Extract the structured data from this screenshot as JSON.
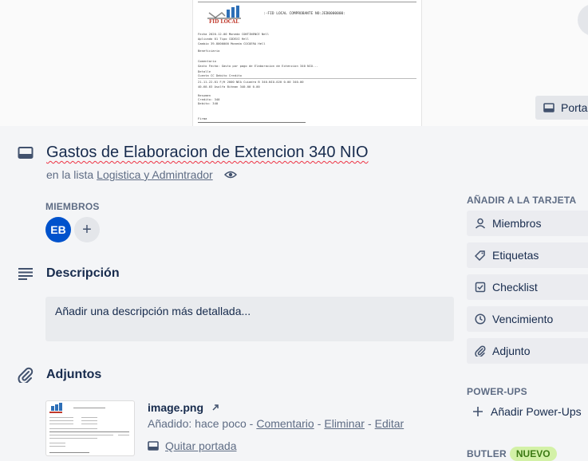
{
  "cover": {
    "doc_logo_text": "FID LOCAL",
    "doc_title": ":-FID LOCAL COMPROBANTE NO:JED0000000:",
    "doc_rows": [
      "Fecha        2020-12-00           Moneda      CONTINENCE         Nell",
      "Aplicado     01                   Tipo        CODEXI             Hell",
      "Cambio       39.8000000           Moneda      COCOERA            Hell",
      "Beneficiario",
      "Comentario",
      "Gasto Fecha: Gasto por pago de Elaboracion de Extencion 340 NIO...",
      "Detalle",
      "Cuenta                    CC                    Debito       Credito",
      "21-11-22-01 F/H 2000 NEA Cuiadra B 340-NIO-020        0.00       340.00",
      "40-60-03 Asolfa Bitman                               340.00         0.00",
      "Resumen",
      "Credito:      340",
      "Debito:       340",
      "Firma"
    ]
  },
  "cover_button": {
    "label": "Porta"
  },
  "card": {
    "title": "Gastos de Elaboracion de Extencion 340 NIO",
    "in_list_prefix": "en la lista",
    "list_name": "Logistica y Admintrador"
  },
  "members": {
    "label": "MIEMBROS",
    "avatar_initials": "EB",
    "add_symbol": "+"
  },
  "description": {
    "title": "Descripción",
    "placeholder": "Añadir una descripción más detallada..."
  },
  "attachments": {
    "title": "Adjuntos",
    "items": [
      {
        "name": "image.png",
        "added_prefix": "Añadido: hace poco -",
        "comment": "Comentario",
        "sep1": "-",
        "delete": "Eliminar",
        "sep2": "-",
        "edit": "Editar",
        "remove_cover": "Quitar portada"
      }
    ]
  },
  "sidebar": {
    "add_to_card_label": "AÑADIR A LA TARJETA",
    "buttons": [
      {
        "label": "Miembros",
        "icon": "person-icon"
      },
      {
        "label": "Etiquetas",
        "icon": "tag-icon"
      },
      {
        "label": "Checklist",
        "icon": "checkbox-icon"
      },
      {
        "label": "Vencimiento",
        "icon": "clock-icon"
      },
      {
        "label": "Adjunto",
        "icon": "paperclip-icon"
      }
    ],
    "powerups_label": "POWER-UPS",
    "add_powerups": "Añadir Power-Ups",
    "butler_label": "BUTLER",
    "butler_badge": "NUEVO"
  },
  "colors": {
    "avatar": "#0052cc",
    "badge_bg": "#d3f1a7",
    "background": "#f4f5f7"
  }
}
